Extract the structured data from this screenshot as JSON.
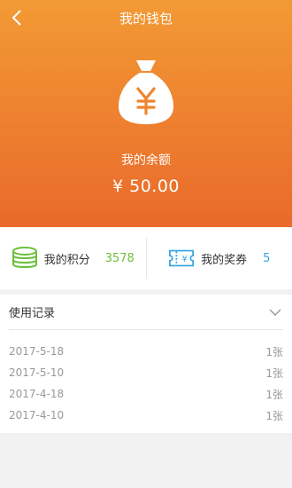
{
  "header": {
    "title": "我的钱包",
    "back_icon": "chevron-left-icon"
  },
  "wallet": {
    "icon": "money-bag-icon",
    "balance_label": "我的余额",
    "balance_amount": "¥ 50.00"
  },
  "stats": {
    "points": {
      "icon": "coin-stack-icon",
      "label": "我的积分",
      "value": "3578",
      "color": "#6cbf3c"
    },
    "vouchers": {
      "icon": "voucher-icon",
      "label": "我的奖券",
      "value": "5",
      "color": "#2fa3e0"
    }
  },
  "records": {
    "title": "使用记录",
    "toggle_icon": "chevron-down-icon",
    "rows": [
      {
        "date": "2017-5-18",
        "count": "1张"
      },
      {
        "date": "2017-5-10",
        "count": "1张"
      },
      {
        "date": "2017-4-18",
        "count": "1张"
      },
      {
        "date": "2017-4-10",
        "count": "1张"
      }
    ]
  },
  "colors": {
    "header_gradient_top": "#f29a35",
    "header_gradient_bottom": "#e96a2c"
  }
}
